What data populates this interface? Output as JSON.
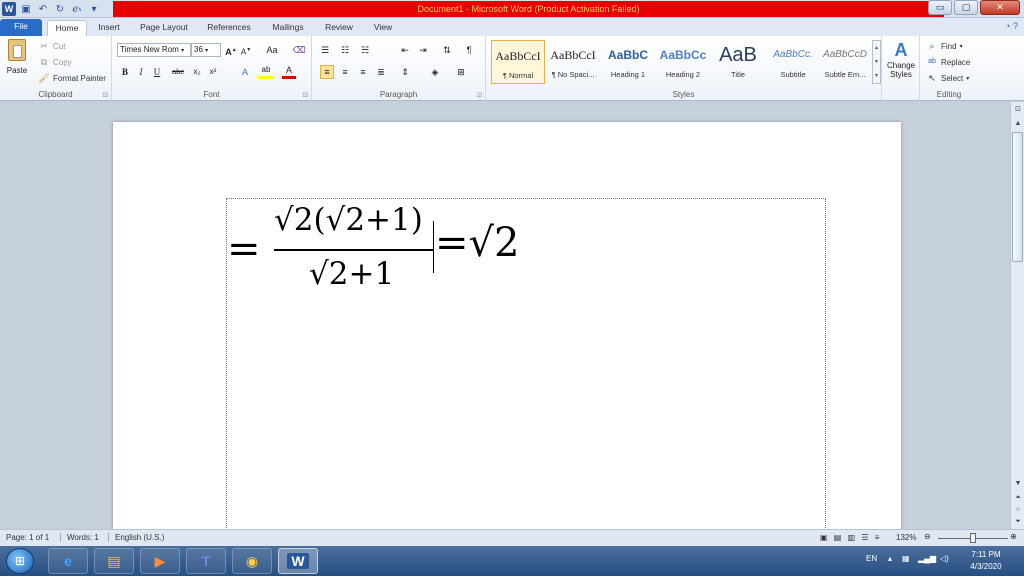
{
  "window": {
    "title": "Document1 - Microsoft Word (Product Activation Failed)",
    "controls": {
      "minimize": "▭",
      "maximize": "▢",
      "close": "✕"
    }
  },
  "qat": {
    "word_logo": "W",
    "save": "💾",
    "undo": "↶",
    "redo": "↻",
    "equation": "e",
    "customize": "▾"
  },
  "tabs": {
    "file": "File",
    "items": [
      "Home",
      "Insert",
      "Page Layout",
      "References",
      "Mailings",
      "Review",
      "View"
    ],
    "active": "Home"
  },
  "ribbon": {
    "clipboard": {
      "label": "Clipboard",
      "paste": "Paste",
      "cut": "Cut",
      "copy": "Copy",
      "format_painter": "Format Painter"
    },
    "font": {
      "label": "Font",
      "font_name": "Times New Rom",
      "font_size": "36",
      "grow": "A",
      "shrink": "A",
      "change_case": "Aa",
      "bold": "B",
      "italic": "I",
      "underline": "U",
      "strike": "abc",
      "subscript": "x₂",
      "superscript": "x²",
      "text_effects": "A",
      "highlight": "ab",
      "font_color": "A"
    },
    "paragraph": {
      "label": "Paragraph"
    },
    "styles": {
      "label": "Styles",
      "items": [
        {
          "sample": "AaBbCcI",
          "name": "¶ Normal"
        },
        {
          "sample": "AaBbCcI",
          "name": "¶ No Spaci..."
        },
        {
          "sample": "AaBbC",
          "name": "Heading 1"
        },
        {
          "sample": "AaBbCc",
          "name": "Heading 2"
        },
        {
          "sample": "AaB",
          "name": "Title"
        },
        {
          "sample": "AaBbCc.",
          "name": "Subtitle"
        },
        {
          "sample": "AaBbCcD",
          "name": "Subtle Em..."
        }
      ],
      "change_styles": "Change Styles"
    },
    "editing": {
      "label": "Editing",
      "find": "Find",
      "replace": "Replace",
      "select": "Select"
    }
  },
  "document": {
    "equation": {
      "equals_left": "=",
      "numerator": "√2(√2+1)",
      "denominator": "√2+1",
      "equals_right": "=√2"
    }
  },
  "status": {
    "page": "Page: 1 of 1",
    "words": "Words: 1",
    "language": "English (U.S.)",
    "zoom": "132%"
  },
  "taskbar": {
    "language": "EN",
    "time": "7:11 PM",
    "date": "4/3/2020"
  },
  "colors": {
    "title_bar_alert": "#e60000",
    "title_text": "#f5d25a",
    "file_tab": "#2a6bc8",
    "taskbar": "#274f82"
  }
}
